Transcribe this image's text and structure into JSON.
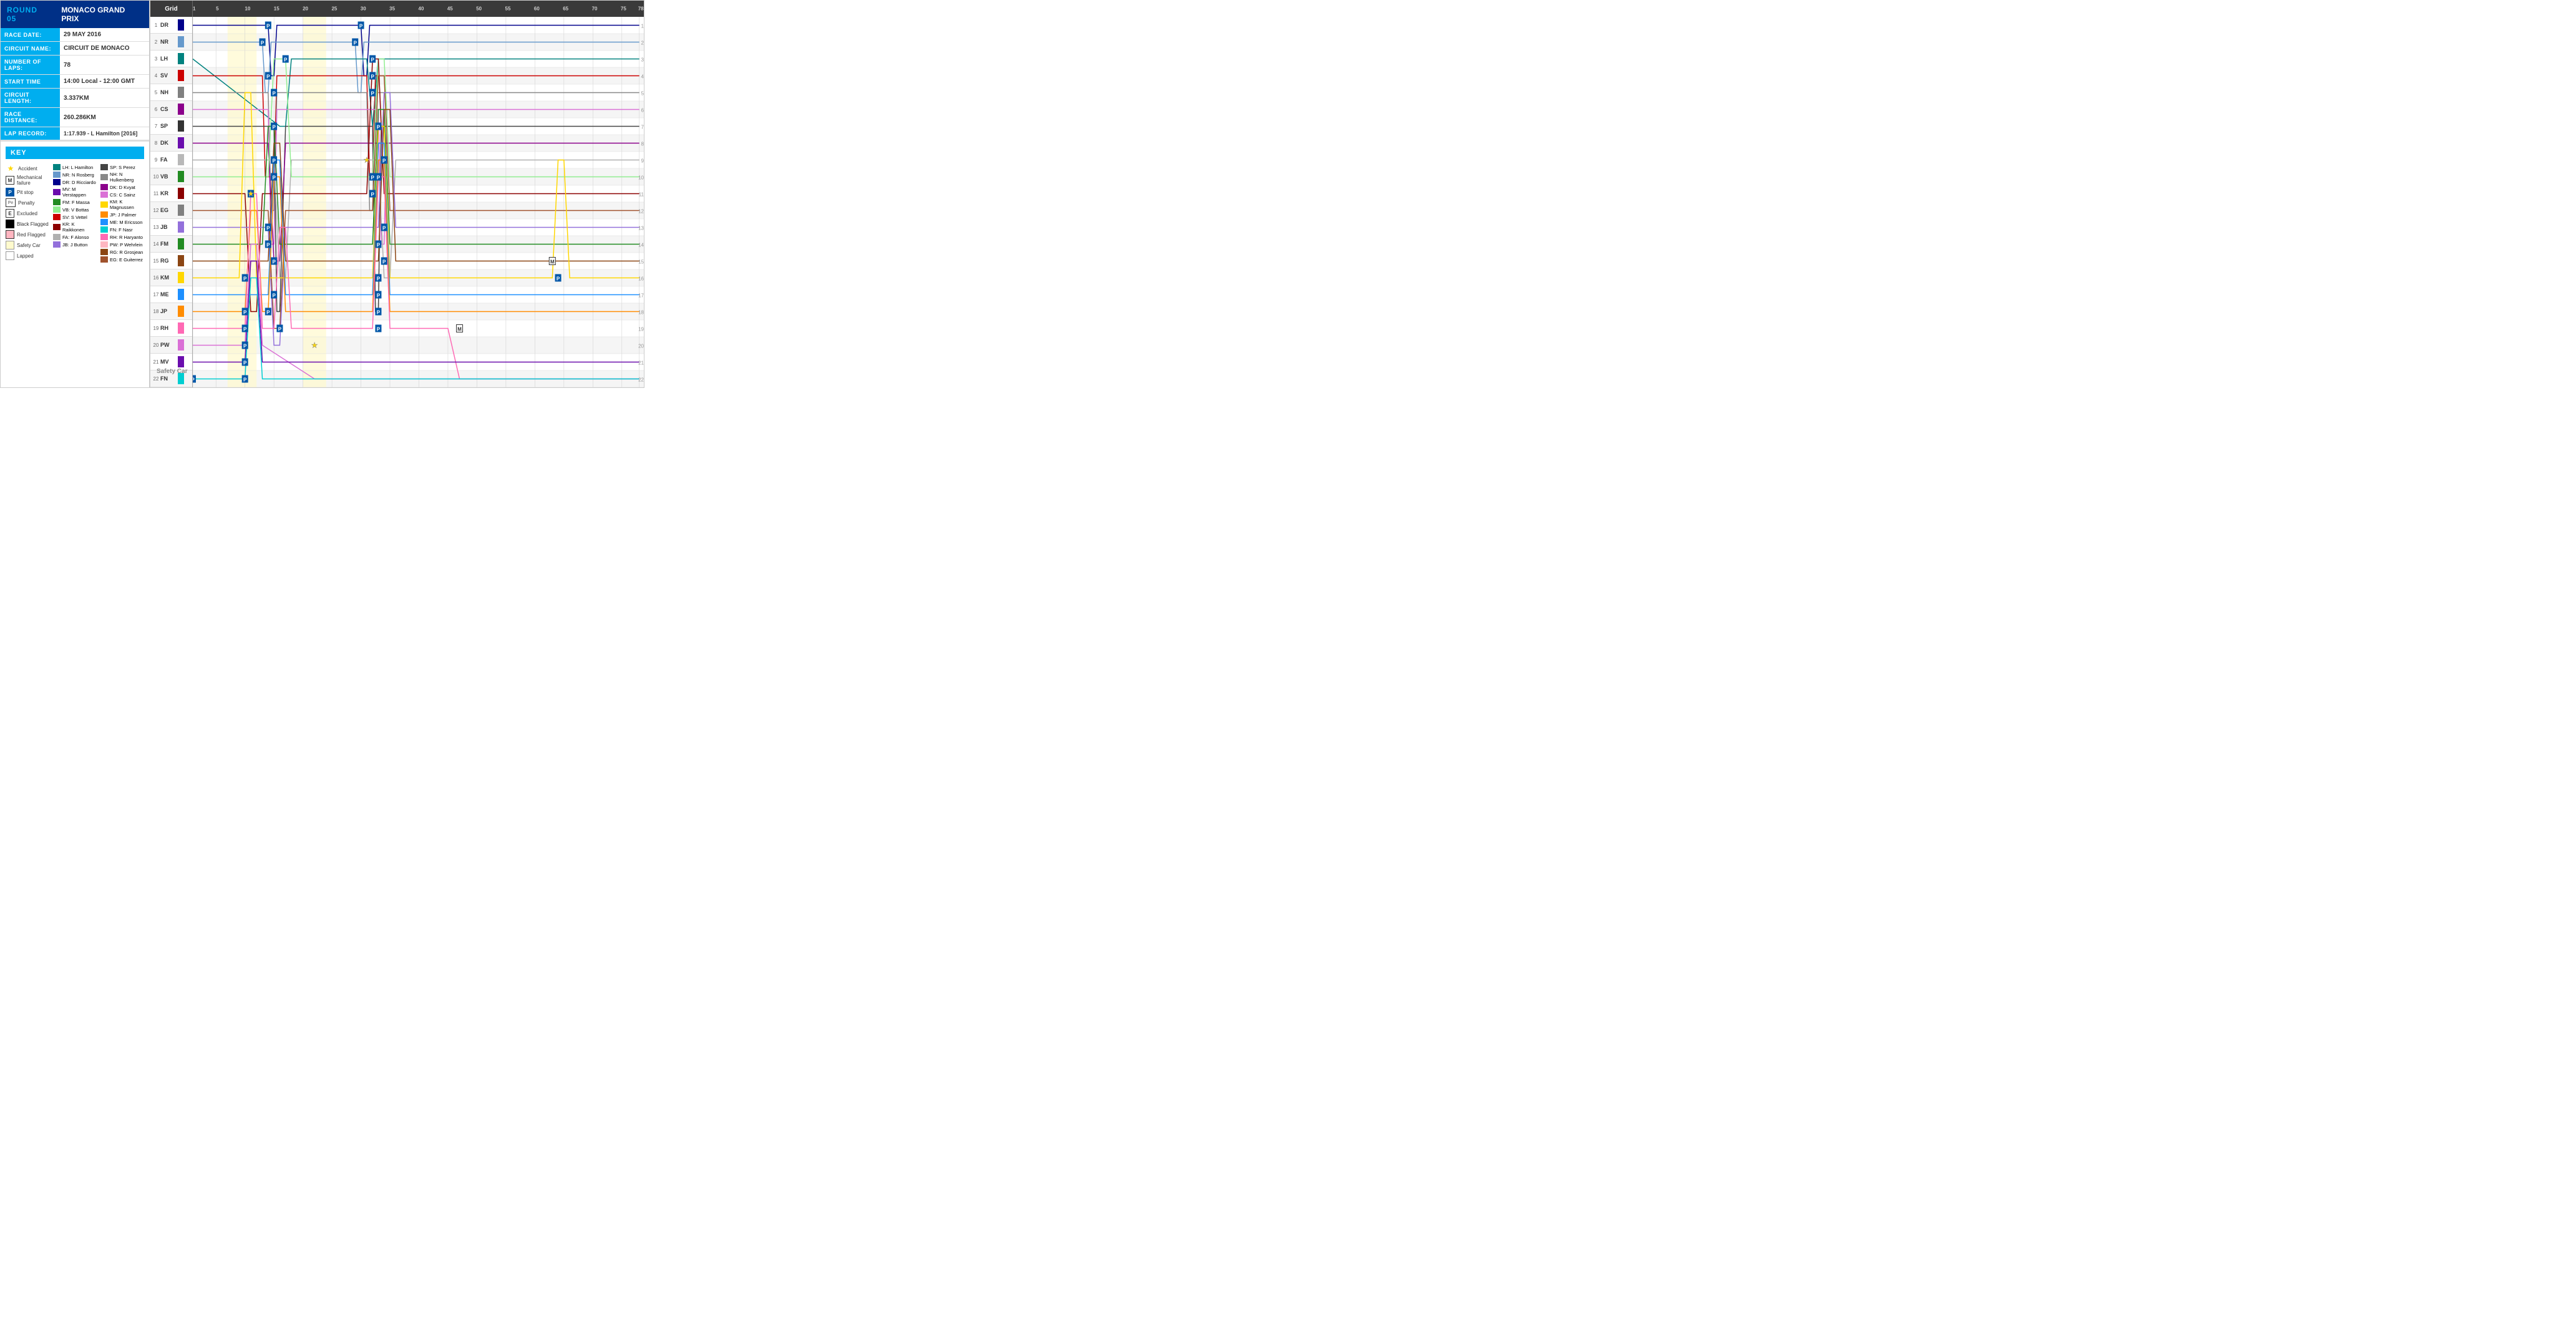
{
  "left": {
    "round": "ROUND 05",
    "race_name": "MONACO GRAND PRIX",
    "race_date_label": "RACE DATE:",
    "race_date_value": "29 MAY 2016",
    "circuit_name_label": "CIRCUIT NAME:",
    "circuit_name_value": "CIRCUIT DE MONACO",
    "number_of_laps_label": "NUMBER OF LAPS:",
    "number_of_laps_value": "78",
    "start_time_label": "START TIME",
    "start_time_value": "14:00 Local - 12:00 GMT",
    "circuit_length_label": "CIRCUIT LENGTH:",
    "circuit_length_value": "3.337KM",
    "race_distance_label": "RACE DISTANCE:",
    "race_distance_value": "260.286KM",
    "lap_record_label": "LAP RECORD:",
    "lap_record_value": "1:17.939 - L Hamilton [2016]",
    "key_label": "KEY",
    "key_items": [
      {
        "symbol": "star",
        "label": "Accident"
      },
      {
        "symbol": "M",
        "label": "Mechanical failure"
      },
      {
        "symbol": "P",
        "label": "Pit stop"
      },
      {
        "symbol": "Pe",
        "label": "Penalty"
      },
      {
        "symbol": "E",
        "label": "Excluded"
      },
      {
        "symbol": "bf",
        "label": "Black Flagged"
      },
      {
        "symbol": "rf",
        "label": "Red Flagged"
      },
      {
        "symbol": "sc",
        "label": "Safety Car"
      },
      {
        "symbol": "lp",
        "label": "Lapped"
      }
    ],
    "drivers_left": [
      {
        "color": "#00827F",
        "code": "LH",
        "name": "L Hamilton"
      },
      {
        "color": "#87CEEB",
        "code": "NR",
        "name": "N Rosberg"
      },
      {
        "color": "#00008B",
        "code": "DR",
        "name": "D Ricciardo"
      },
      {
        "color": "#6A0DAD",
        "code": "MV",
        "name": "M Verstappen"
      },
      {
        "color": "#228B22",
        "code": "FM",
        "name": "F Massa"
      },
      {
        "color": "#90EE90",
        "code": "VB",
        "name": "V Bottas"
      },
      {
        "color": "#CC0000",
        "code": "SV",
        "name": "S Vettel"
      },
      {
        "color": "#8B0000",
        "code": "KR",
        "name": "K Raikkonen"
      },
      {
        "color": "#B8B8B8",
        "code": "FA",
        "name": "F Alonso"
      },
      {
        "color": "#9370DB",
        "code": "JB",
        "name": "J Button"
      }
    ],
    "drivers_right": [
      {
        "color": "#333333",
        "code": "SP",
        "name": "S Perez"
      },
      {
        "color": "#808080",
        "code": "NH",
        "name": "N Hulkenberg"
      },
      {
        "color": "#8B008B",
        "code": "DK",
        "name": "D Kvyat"
      },
      {
        "color": "#DA70D6",
        "code": "CS",
        "name": "C Sainz"
      },
      {
        "color": "#FFD700",
        "code": "KM",
        "name": "K Magnussen"
      },
      {
        "color": "#FF8C00",
        "code": "JP",
        "name": "J Palmer"
      },
      {
        "color": "#1E90FF",
        "code": "ME",
        "name": "M Ericsson"
      },
      {
        "color": "#00CED1",
        "code": "FN",
        "name": "F Nasr"
      },
      {
        "color": "#FF69B4",
        "code": "RH",
        "name": "R Haryanto"
      },
      {
        "color": "#FFB6C1",
        "code": "PW",
        "name": "P Wehrlein"
      },
      {
        "color": "#8B4513",
        "code": "RG",
        "name": "R Grosjean"
      },
      {
        "color": "#A0522D",
        "code": "EG",
        "name": "E Guiterrez"
      }
    ]
  },
  "chart": {
    "grid_label": "Grid",
    "laps": [
      1,
      5,
      10,
      15,
      20,
      25,
      30,
      35,
      40,
      45,
      50,
      55,
      60,
      65,
      70,
      75,
      78
    ],
    "rows": [
      {
        "pos": 1,
        "code": "DR",
        "color": "#00008B",
        "start_color": "#00008B"
      },
      {
        "pos": 2,
        "code": "NR",
        "color": "#87CEEB",
        "start_color": "#6699CC"
      },
      {
        "pos": 3,
        "code": "LH",
        "color": "#00827F",
        "start_color": "#00827F"
      },
      {
        "pos": 4,
        "code": "SV",
        "color": "#CC0000",
        "start_color": "#CC0000"
      },
      {
        "pos": 5,
        "code": "NH",
        "color": "#808080",
        "start_color": "#808080"
      },
      {
        "pos": 6,
        "code": "CS",
        "color": "#DA70D6",
        "start_color": "#8B008B"
      },
      {
        "pos": 7,
        "code": "SP",
        "color": "#333333",
        "start_color": "#333333"
      },
      {
        "pos": 8,
        "code": "DK",
        "color": "#8B008B",
        "start_color": "#6A0DAD"
      },
      {
        "pos": 9,
        "code": "FA",
        "color": "#B8B8B8",
        "start_color": "#B8B8B8"
      },
      {
        "pos": 10,
        "code": "VB",
        "color": "#90EE90",
        "start_color": "#228B22"
      },
      {
        "pos": 11,
        "code": "KR",
        "color": "#8B0000",
        "start_color": "#8B0000"
      },
      {
        "pos": 12,
        "code": "EG",
        "color": "#A0522D",
        "start_color": "#808080"
      },
      {
        "pos": 13,
        "code": "JB",
        "color": "#9370DB",
        "start_color": "#9370DB"
      },
      {
        "pos": 14,
        "code": "FM",
        "color": "#228B22",
        "start_color": "#228B22"
      },
      {
        "pos": 15,
        "code": "RG",
        "color": "#8B4513",
        "start_color": "#8B4513"
      },
      {
        "pos": 16,
        "code": "KM",
        "color": "#FFD700",
        "start_color": "#FFD700"
      },
      {
        "pos": 17,
        "code": "ME",
        "color": "#1E90FF",
        "start_color": "#1E90FF"
      },
      {
        "pos": 18,
        "code": "JP",
        "color": "#FF8C00",
        "start_color": "#FF8C00"
      },
      {
        "pos": 19,
        "code": "RH",
        "color": "#FF69B4",
        "start_color": "#FF69B4"
      },
      {
        "pos": 20,
        "code": "PW",
        "color": "#FFB6C1",
        "start_color": "#DA70D6"
      },
      {
        "pos": 21,
        "code": "MV",
        "color": "#6A0DAD",
        "start_color": "#6A0DAD"
      },
      {
        "pos": 22,
        "code": "FN",
        "color": "#00CED1",
        "start_color": "#00CED1"
      }
    ]
  }
}
